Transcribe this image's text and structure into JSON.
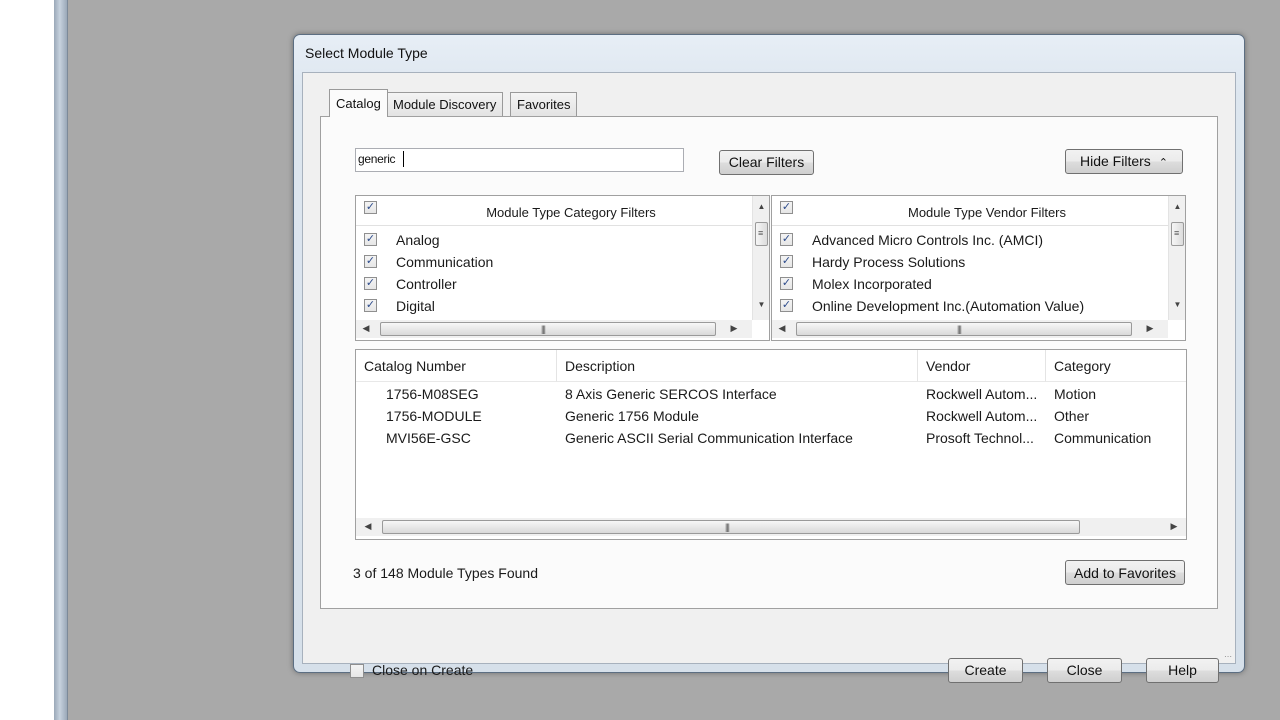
{
  "dialog": {
    "title": "Select Module Type",
    "tabs": [
      {
        "label": "Catalog",
        "active": true
      },
      {
        "label": "Module Discovery",
        "active": false
      },
      {
        "label": "Favorites",
        "active": false
      }
    ],
    "search": {
      "value": "generic"
    },
    "clear_filters_label": "Clear Filters",
    "hide_filters_label": "Hide Filters",
    "hide_filters_icon": "double-chevron-up-icon",
    "category_filters": {
      "header": "Module Type Category Filters",
      "items": [
        {
          "label": "Analog",
          "checked": true
        },
        {
          "label": "Communication",
          "checked": true
        },
        {
          "label": "Controller",
          "checked": true
        },
        {
          "label": "Digital",
          "checked": true
        }
      ]
    },
    "vendor_filters": {
      "header": "Module Type Vendor Filters",
      "items": [
        {
          "label": "Advanced Micro Controls Inc. (AMCI)",
          "checked": true
        },
        {
          "label": "Hardy Process Solutions",
          "checked": true
        },
        {
          "label": "Molex Incorporated",
          "checked": true
        },
        {
          "label": "Online Development Inc.(Automation Value)",
          "checked": true
        }
      ]
    },
    "results": {
      "columns": [
        "Catalog Number",
        "Description",
        "Vendor",
        "Category"
      ],
      "rows": [
        [
          "1756-M08SEG",
          "8 Axis Generic SERCOS Interface",
          "Rockwell Autom...",
          "Motion"
        ],
        [
          "1756-MODULE",
          "Generic 1756 Module",
          "Rockwell Autom...",
          "Other"
        ],
        [
          "MVI56E-GSC",
          "Generic ASCII Serial Communication Interface",
          "Prosoft Technol...",
          "Communication"
        ]
      ]
    },
    "found_text": "3 of 148 Module Types Found",
    "add_to_favorites_label": "Add to Favorites",
    "close_on_create": {
      "label": "Close on Create",
      "checked": false
    },
    "buttons": {
      "create": "Create",
      "close": "Close",
      "help": "Help"
    }
  }
}
